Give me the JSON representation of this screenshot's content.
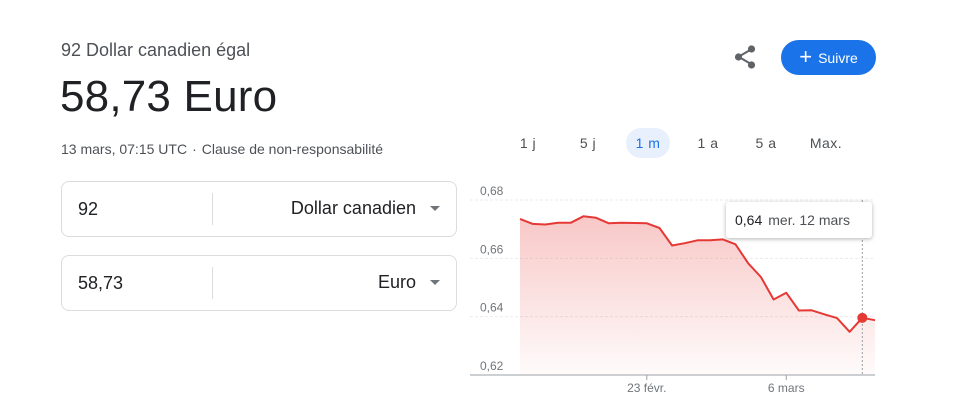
{
  "header": {
    "subtitle": "92 Dollar canadien égal",
    "value": "58,73 Euro",
    "timestamp": "13 mars, 07:15 UTC",
    "separator": "·",
    "disclaimer": "Clause de non-responsabilité"
  },
  "actions": {
    "share_icon": "share-icon",
    "follow_icon": "+",
    "follow_label": "Suivre",
    "accent_color": "#1a73e8"
  },
  "converter": [
    {
      "amount": "92",
      "currency": "Dollar canadien"
    },
    {
      "amount": "58,73",
      "currency": "Euro"
    }
  ],
  "range_tabs": [
    {
      "label": "1 j",
      "active": false
    },
    {
      "label": "5 j",
      "active": false
    },
    {
      "label": "1 m",
      "active": true
    },
    {
      "label": "1 a",
      "active": false
    },
    {
      "label": "5 a",
      "active": false
    },
    {
      "label": "Max.",
      "active": false
    }
  ],
  "tooltip": {
    "value": "0,64",
    "date": "mer. 12 mars"
  },
  "chart_data": {
    "type": "area",
    "line_color": "#e53935",
    "y_ticks": [
      "0,68",
      "0,66",
      "0,64",
      "0,62"
    ],
    "ylim": [
      0.62,
      0.68
    ],
    "x_ticks": [
      {
        "label": "23 févr.",
        "index": 10
      },
      {
        "label": "6 mars",
        "index": 21
      }
    ],
    "values": [
      0.6735,
      0.6718,
      0.6716,
      0.6722,
      0.6722,
      0.6744,
      0.6739,
      0.672,
      0.6722,
      0.6721,
      0.672,
      0.6704,
      0.6644,
      0.6652,
      0.6662,
      0.6662,
      0.6665,
      0.6648,
      0.6583,
      0.6536,
      0.6459,
      0.6482,
      0.6421,
      0.6422,
      0.6408,
      0.6395,
      0.6348,
      0.6396,
      0.6388
    ],
    "highlight_index": 27,
    "grid": true
  }
}
